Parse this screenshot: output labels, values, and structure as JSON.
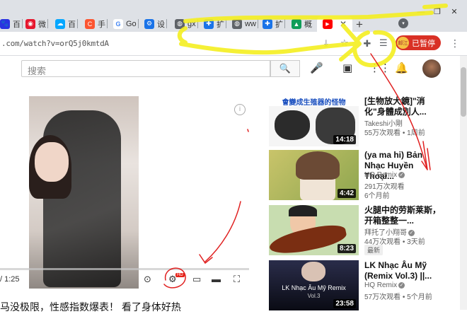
{
  "tabs": [
    {
      "label": "百",
      "icon": "paw-icon",
      "color": "#2932e1"
    },
    {
      "label": "微",
      "icon": "weibo-icon",
      "color": "#e6162d"
    },
    {
      "label": "百",
      "icon": "baidu-netdisk-icon",
      "color": "#06a7ff"
    },
    {
      "label": "手",
      "icon": "c-logo-icon",
      "color": "#fc5531"
    },
    {
      "label": "Go",
      "icon": "google-icon",
      "color": "#4285f4"
    },
    {
      "label": "设",
      "icon": "settings-gear-icon",
      "color": "#1a73e8"
    },
    {
      "label": "gx",
      "icon": "globe-icon",
      "color": "#5f6368"
    },
    {
      "label": "扩",
      "icon": "puzzle-icon",
      "color": "#1a73e8"
    },
    {
      "label": "ww",
      "icon": "globe-icon",
      "color": "#5f6368"
    },
    {
      "label": "扩",
      "icon": "puzzle-icon",
      "color": "#1a73e8"
    },
    {
      "label": "概",
      "icon": "drive-icon",
      "color": "#0f9d58"
    },
    {
      "label": "",
      "icon": "youtube-icon",
      "color": "#ff0000",
      "active": true
    }
  ],
  "toolbar": {
    "url": ".com/watch?v=orQ5j0kmtdA",
    "profile_label": "已暂停",
    "profile_avatar_text": "邮江"
  },
  "youtube": {
    "search_placeholder": "搜索"
  },
  "player": {
    "time": "/ 1:25",
    "hd_badge": "HD",
    "title": "马没极限，性感指数爆表！ 看了身体好热"
  },
  "recommendations": [
    {
      "title": "[生物放大鏡]\"消化\"身體成別人...",
      "channel": "Takeshi小剛",
      "verified": false,
      "meta": "55万次观看 • 1周前",
      "duration": "14:18",
      "thumb_caption": "會變成生殖器的怪物",
      "thumb_colors": [
        "#f5f5f5",
        "#2b2b2b"
      ]
    },
    {
      "title": "(ya ma hi) Bản Nhạc Huyền Thoại...",
      "channel": "HQ Remix",
      "verified": true,
      "meta1": "291万次观看",
      "meta2": "6个月前",
      "duration": "4:42",
      "thumb_colors": [
        "#c9c46a",
        "#f0e4d6"
      ]
    },
    {
      "title": "火腿中的劳斯莱斯，开箱整整一...",
      "channel": "拜托了小翔哥",
      "verified": true,
      "meta": "44万次观看 • 3天前",
      "badge": "最新",
      "duration": "8:23",
      "thumb_colors": [
        "#c8ddb0",
        "#7a2e12"
      ]
    },
    {
      "title": "LK Nhạc Âu Mỹ (Remix Vol.3) ||...",
      "channel": "HQ Remix",
      "verified": true,
      "meta": "57万次观看 • 5个月前",
      "duration": "23:58",
      "thumb_caption": "LK Nhạc Âu Mỹ Remix",
      "thumb_caption2": "Vol.3",
      "thumb_colors": [
        "#2a2d4a",
        "#0a0b14"
      ]
    }
  ]
}
